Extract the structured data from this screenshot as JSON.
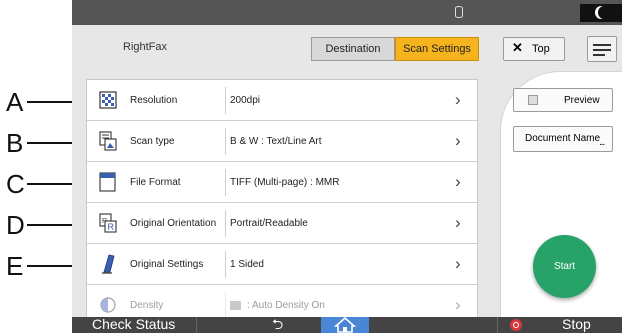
{
  "callouts": [
    "A",
    "B",
    "C",
    "D",
    "E"
  ],
  "header": {
    "app_title": "RightFax",
    "tabs": [
      {
        "label": "Destination",
        "selected": false
      },
      {
        "label": "Scan Settings",
        "selected": true
      }
    ],
    "top_button": "Top",
    "accent_color": "#f6b41c"
  },
  "settings": [
    {
      "name": "Resolution",
      "value": "200dpi",
      "icon": "resolution-icon"
    },
    {
      "name": "Scan type",
      "value": "B & W : Text/Line Art",
      "icon": "scan-type-icon"
    },
    {
      "name": "File Format",
      "value": "TIFF (Multi-page) : MMR",
      "icon": "file-format-icon"
    },
    {
      "name": "Original Orientation",
      "value": "Portrait/Readable",
      "icon": "orientation-icon"
    },
    {
      "name": "Original Settings",
      "value": "1 Sided",
      "icon": "original-settings-icon"
    },
    {
      "name": "Density",
      "value": ": Auto Density On",
      "icon": "density-icon"
    }
  ],
  "side": {
    "preview": "Preview",
    "document_name": "Document Name",
    "document_name_dots": "...",
    "start": "Start",
    "start_color": "#27a36a"
  },
  "bottom": {
    "check_status": "Check Status",
    "stop": "Stop"
  }
}
